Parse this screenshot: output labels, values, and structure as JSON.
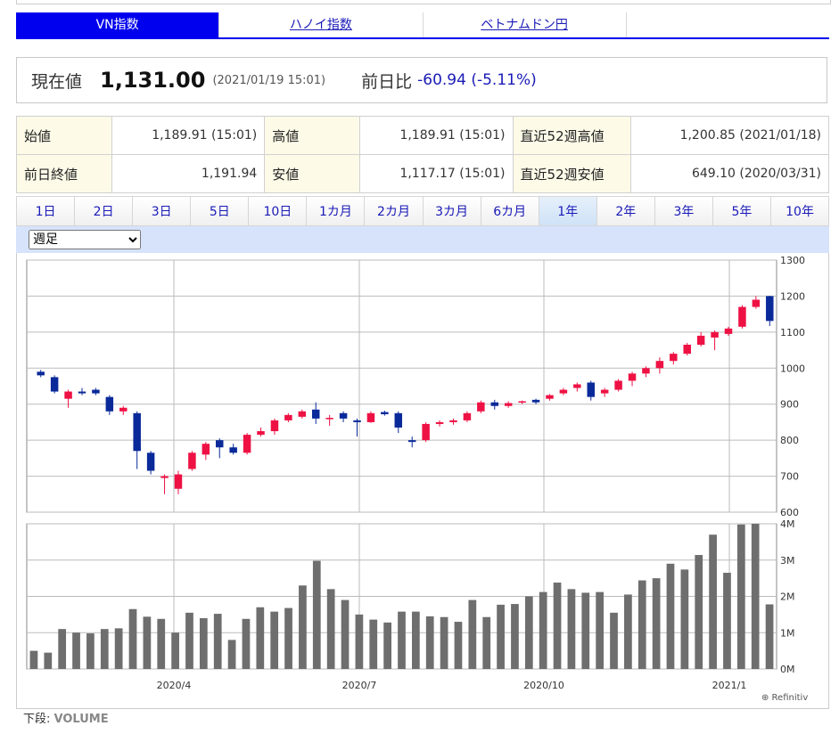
{
  "tabs": [
    {
      "label": "VN指数",
      "active": true
    },
    {
      "label": "ハノイ指数",
      "active": false
    },
    {
      "label": "ベトナムドン円",
      "active": false
    }
  ],
  "price": {
    "label": "現在値",
    "value": "1,131.00",
    "timestamp": "(2021/01/19 15:01)",
    "change_label": "前日比",
    "change": "-60.94 (-5.11%)"
  },
  "stats": {
    "open_label": "始値",
    "open": "1,189.91 (15:01)",
    "high_label": "高値",
    "high": "1,189.91 (15:01)",
    "high52_label": "直近52週高値",
    "high52": "1,200.85 (2021/01/18)",
    "prev_label": "前日終値",
    "prev": "1,191.94",
    "low_label": "安値",
    "low": "1,117.17 (15:01)",
    "low52_label": "直近52週安値",
    "low52": "649.10 (2020/03/31)"
  },
  "periods": [
    "1日",
    "2日",
    "3日",
    "5日",
    "10日",
    "1カ月",
    "2カ月",
    "3カ月",
    "6カ月",
    "1年",
    "2年",
    "3年",
    "5年",
    "10年"
  ],
  "active_period": "1年",
  "interval_select": {
    "selected": "週足"
  },
  "footnote": {
    "prefix": "下段:",
    "label": "VOLUME"
  },
  "credit": "⊕ Refinitiv",
  "colors": {
    "up": "#ee1144",
    "down": "#0a2a9a",
    "volume": "#6e6e6e",
    "tab_active": "#0000ee"
  },
  "chart_data": [
    {
      "type": "candlestick",
      "y_ticks": [
        "1300",
        "1200",
        "1100",
        "1000",
        "900",
        "800",
        "700",
        "600"
      ],
      "ylim": [
        600,
        1300
      ],
      "x_ticks": [
        "2020/4",
        "2020/7",
        "2020/10",
        "2021/1"
      ],
      "grid": true,
      "candles": [
        {
          "o": 990,
          "h": 995,
          "l": 975,
          "c": 980
        },
        {
          "o": 975,
          "h": 980,
          "l": 930,
          "c": 935
        },
        {
          "o": 915,
          "h": 940,
          "l": 890,
          "c": 935
        },
        {
          "o": 935,
          "h": 945,
          "l": 925,
          "c": 930
        },
        {
          "o": 940,
          "h": 945,
          "l": 925,
          "c": 930
        },
        {
          "o": 920,
          "h": 925,
          "l": 870,
          "c": 880
        },
        {
          "o": 880,
          "h": 895,
          "l": 870,
          "c": 890
        },
        {
          "o": 875,
          "h": 880,
          "l": 720,
          "c": 770
        },
        {
          "o": 765,
          "h": 770,
          "l": 705,
          "c": 715
        },
        {
          "o": 695,
          "h": 705,
          "l": 650,
          "c": 700
        },
        {
          "o": 665,
          "h": 715,
          "l": 650,
          "c": 705
        },
        {
          "o": 720,
          "h": 770,
          "l": 715,
          "c": 765
        },
        {
          "o": 760,
          "h": 795,
          "l": 745,
          "c": 790
        },
        {
          "o": 800,
          "h": 805,
          "l": 750,
          "c": 780
        },
        {
          "o": 780,
          "h": 790,
          "l": 760,
          "c": 765
        },
        {
          "o": 765,
          "h": 820,
          "l": 760,
          "c": 815
        },
        {
          "o": 815,
          "h": 835,
          "l": 810,
          "c": 825
        },
        {
          "o": 825,
          "h": 860,
          "l": 815,
          "c": 855
        },
        {
          "o": 855,
          "h": 875,
          "l": 850,
          "c": 870
        },
        {
          "o": 865,
          "h": 885,
          "l": 860,
          "c": 880
        },
        {
          "o": 885,
          "h": 905,
          "l": 845,
          "c": 860
        },
        {
          "o": 860,
          "h": 870,
          "l": 840,
          "c": 862
        },
        {
          "o": 875,
          "h": 880,
          "l": 850,
          "c": 860
        },
        {
          "o": 855,
          "h": 860,
          "l": 810,
          "c": 850
        },
        {
          "o": 850,
          "h": 880,
          "l": 848,
          "c": 875
        },
        {
          "o": 878,
          "h": 882,
          "l": 868,
          "c": 872
        },
        {
          "o": 875,
          "h": 880,
          "l": 820,
          "c": 835
        },
        {
          "o": 800,
          "h": 810,
          "l": 780,
          "c": 795
        },
        {
          "o": 800,
          "h": 850,
          "l": 795,
          "c": 845
        },
        {
          "o": 845,
          "h": 855,
          "l": 838,
          "c": 850
        },
        {
          "o": 850,
          "h": 860,
          "l": 843,
          "c": 855
        },
        {
          "o": 855,
          "h": 880,
          "l": 850,
          "c": 875
        },
        {
          "o": 880,
          "h": 910,
          "l": 875,
          "c": 905
        },
        {
          "o": 905,
          "h": 912,
          "l": 885,
          "c": 895
        },
        {
          "o": 895,
          "h": 908,
          "l": 890,
          "c": 903
        },
        {
          "o": 905,
          "h": 910,
          "l": 900,
          "c": 908
        },
        {
          "o": 912,
          "h": 915,
          "l": 900,
          "c": 905
        },
        {
          "o": 915,
          "h": 928,
          "l": 910,
          "c": 925
        },
        {
          "o": 930,
          "h": 945,
          "l": 925,
          "c": 940
        },
        {
          "o": 945,
          "h": 960,
          "l": 935,
          "c": 955
        },
        {
          "o": 960,
          "h": 965,
          "l": 910,
          "c": 920
        },
        {
          "o": 930,
          "h": 945,
          "l": 920,
          "c": 940
        },
        {
          "o": 940,
          "h": 970,
          "l": 935,
          "c": 965
        },
        {
          "o": 965,
          "h": 990,
          "l": 950,
          "c": 985
        },
        {
          "o": 985,
          "h": 1005,
          "l": 975,
          "c": 1000
        },
        {
          "o": 1000,
          "h": 1030,
          "l": 985,
          "c": 1020
        },
        {
          "o": 1020,
          "h": 1045,
          "l": 1010,
          "c": 1040
        },
        {
          "o": 1040,
          "h": 1070,
          "l": 1035,
          "c": 1065
        },
        {
          "o": 1065,
          "h": 1100,
          "l": 1060,
          "c": 1090
        },
        {
          "o": 1085,
          "h": 1105,
          "l": 1050,
          "c": 1100
        },
        {
          "o": 1095,
          "h": 1115,
          "l": 1090,
          "c": 1110
        },
        {
          "o": 1115,
          "h": 1175,
          "l": 1110,
          "c": 1170
        },
        {
          "o": 1170,
          "h": 1200,
          "l": 1165,
          "c": 1190
        },
        {
          "o": 1200,
          "h": 1201,
          "l": 1117,
          "c": 1131
        }
      ]
    },
    {
      "type": "bar",
      "y_ticks": [
        "4M",
        "3M",
        "2M",
        "1M",
        "0M"
      ],
      "ylim": [
        0,
        4000000
      ],
      "x_ticks": [
        "2020/4",
        "2020/7",
        "2020/10",
        "2021/1"
      ],
      "grid": true,
      "values": [
        500000,
        450000,
        1100000,
        1000000,
        980000,
        1100000,
        1120000,
        1650000,
        1440000,
        1380000,
        1000000,
        1550000,
        1400000,
        1520000,
        800000,
        1380000,
        1700000,
        1580000,
        1680000,
        2300000,
        2980000,
        2200000,
        1900000,
        1500000,
        1360000,
        1280000,
        1580000,
        1580000,
        1450000,
        1430000,
        1300000,
        1900000,
        1430000,
        1770000,
        1790000,
        2000000,
        2120000,
        2380000,
        2200000,
        2100000,
        2120000,
        1550000,
        2050000,
        2440000,
        2500000,
        2900000,
        2740000,
        3140000,
        3700000,
        2650000,
        3980000,
        4000000,
        1780000
      ]
    }
  ]
}
